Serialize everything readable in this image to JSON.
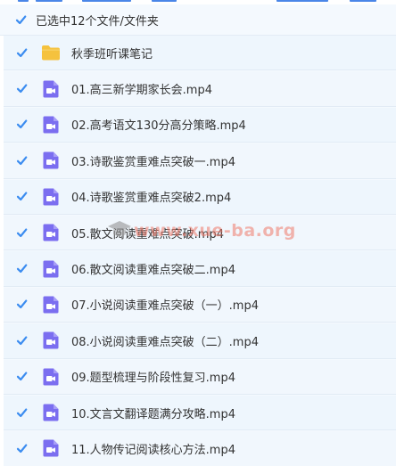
{
  "header": {
    "selection_summary": "已选中12个文件/文件夹",
    "checked": true
  },
  "items": [
    {
      "name": "秋季班听课笔记",
      "type": "folder",
      "checked": true
    },
    {
      "name": "01.高三新学期家长会.mp4",
      "type": "video",
      "checked": true
    },
    {
      "name": "02.高考语文130分高分策略.mp4",
      "type": "video",
      "checked": true
    },
    {
      "name": "03.诗歌鉴赏重难点突破一.mp4",
      "type": "video",
      "checked": true
    },
    {
      "name": "04.诗歌鉴赏重难点突破2.mp4",
      "type": "video",
      "checked": true
    },
    {
      "name": "05.散文阅读重难点突破.mp4",
      "type": "video",
      "checked": true
    },
    {
      "name": "06.散文阅读重难点突破二.mp4",
      "type": "video",
      "checked": true
    },
    {
      "name": "07.小说阅读重难点突破（一）.mp4",
      "type": "video",
      "checked": true
    },
    {
      "name": "08.小说阅读重难点突破（二）.mp4",
      "type": "video",
      "checked": true
    },
    {
      "name": "09.题型梳理与阶段性复习.mp4",
      "type": "video",
      "checked": true
    },
    {
      "name": "10.文言文翻译题满分攻略.mp4",
      "type": "video",
      "checked": true
    },
    {
      "name": "11.人物传记阅读核心方法.mp4",
      "type": "video",
      "checked": true
    }
  ],
  "watermark": {
    "text": "www.xue-ba.org"
  },
  "colors": {
    "checkbox": "#3b8cf0",
    "folder": "#f5c23e",
    "video": "#7b6ef0",
    "row_bg": "#eef6fd"
  },
  "icons": {
    "checkbox": "checkbox-checked-icon",
    "folder": "folder-icon",
    "video": "video-file-icon",
    "watermark": "graduation-cap-icon"
  }
}
